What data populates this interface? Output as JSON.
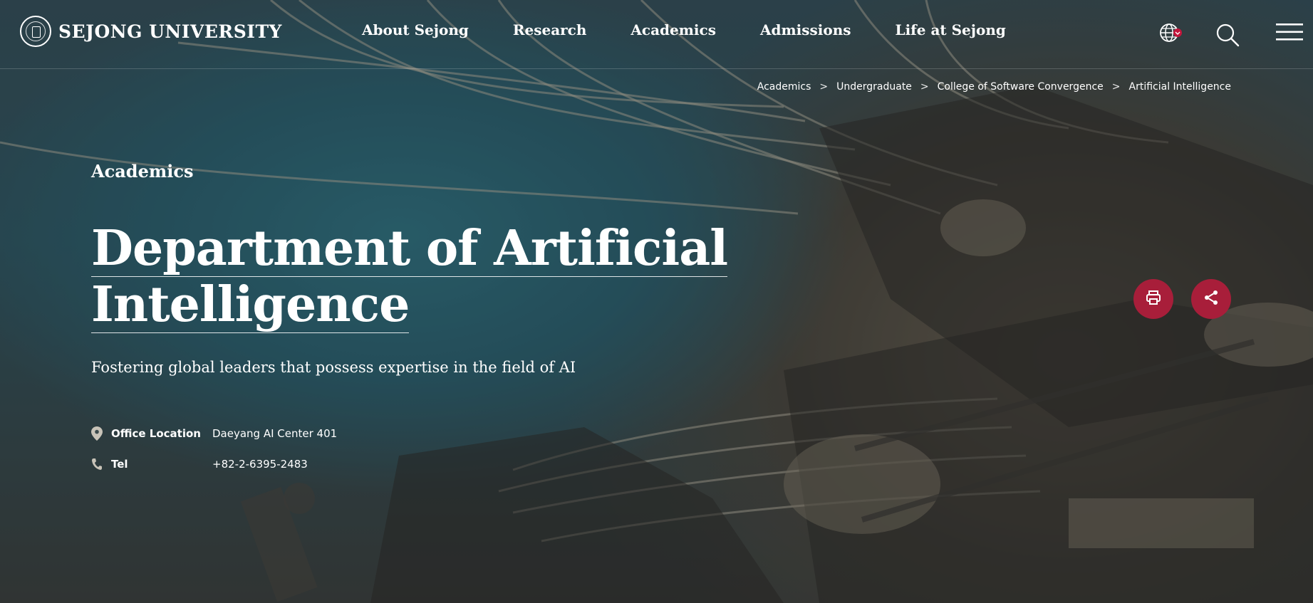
{
  "header": {
    "logo_text": "SEJONG UNIVERSITY",
    "nav": [
      "About Sejong",
      "Research",
      "Academics",
      "Admissions",
      "Life at Sejong"
    ],
    "icons": [
      "globe-icon",
      "search-icon",
      "hamburger-menu-icon"
    ]
  },
  "breadcrumb": {
    "items": [
      "Academics",
      "Undergraduate",
      "College of Software Convergence",
      "Artificial Intelligence"
    ],
    "separator": ">"
  },
  "content": {
    "section_label": "Academics",
    "title_line1": "Department of Artificial",
    "title_line2": "Intelligence",
    "subtitle": "Fostering global leaders that possess expertise in the field of AI",
    "office_label": "Office Location",
    "office_value": "Daeyang AI Center 401",
    "tel_label": "Tel",
    "tel_value": "+82-2-6395-2483"
  },
  "actions": {
    "icons": [
      "print-icon",
      "share-icon"
    ]
  },
  "colors": {
    "accent": "#a81e3a",
    "text": "#ffffff"
  }
}
